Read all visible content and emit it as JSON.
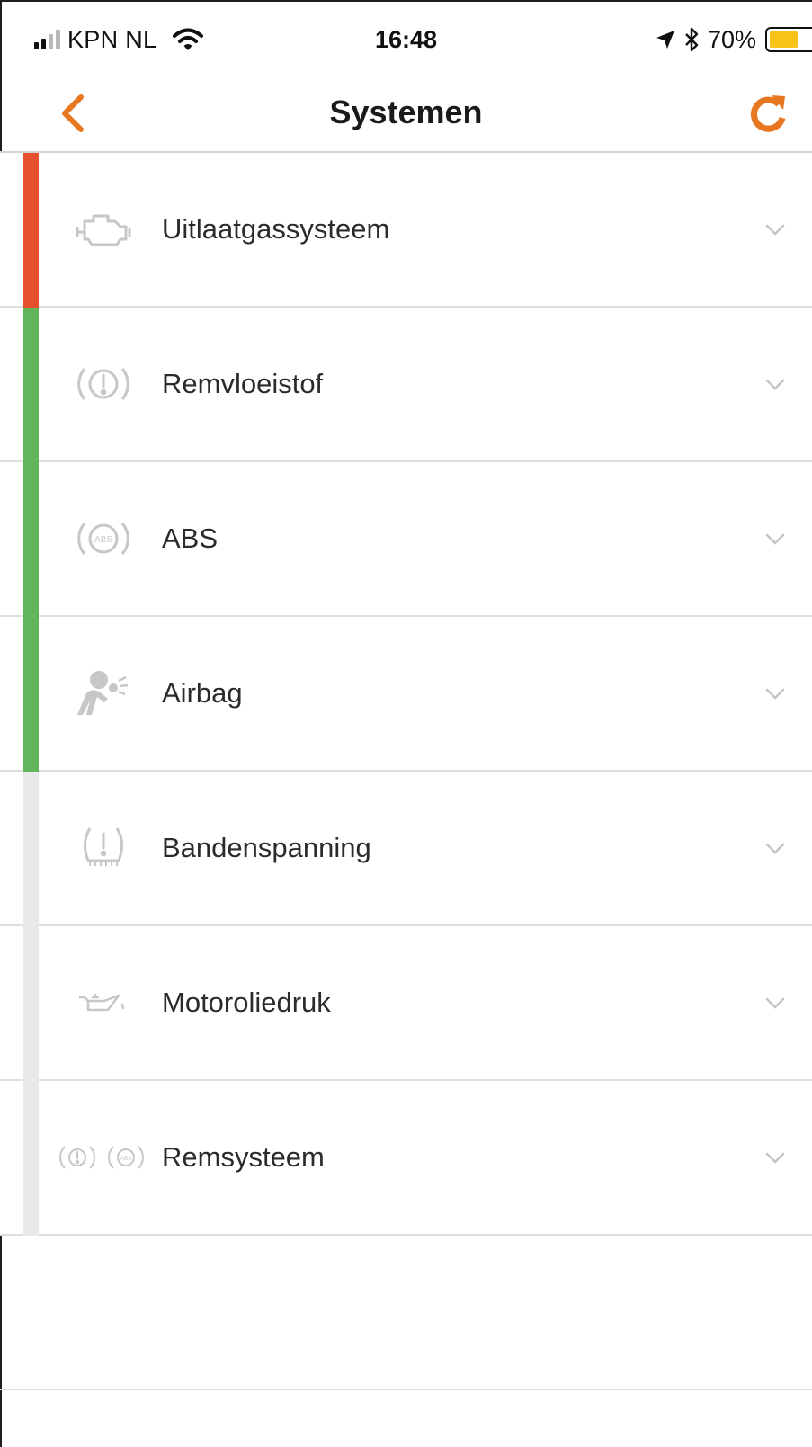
{
  "status_bar": {
    "carrier": "KPN NL",
    "time": "16:48",
    "battery_percent": "70%",
    "battery_level": 0.7,
    "signal_bars_filled": 2,
    "signal_bars_total": 4
  },
  "nav": {
    "title": "Systemen",
    "back_icon": "chevron-left-icon",
    "refresh_icon": "refresh-icon",
    "accent_color": "#e87722"
  },
  "systems": [
    {
      "label": "Uitlaatgassysteem",
      "icon": "engine-icon",
      "status": "error",
      "status_color": "#e5512f"
    },
    {
      "label": "Remvloeistof",
      "icon": "brake-warning-icon",
      "status": "ok",
      "status_color": "#62b55a"
    },
    {
      "label": "ABS",
      "icon": "abs-icon",
      "status": "ok",
      "status_color": "#62b55a"
    },
    {
      "label": "Airbag",
      "icon": "airbag-icon",
      "status": "ok",
      "status_color": "#62b55a"
    },
    {
      "label": "Bandenspanning",
      "icon": "tire-pressure-icon",
      "status": "unknown",
      "status_color": "#e9e9e9"
    },
    {
      "label": "Motoroliedruk",
      "icon": "oil-pressure-icon",
      "status": "unknown",
      "status_color": "#e9e9e9"
    },
    {
      "label": "Remsysteem",
      "icon": "brake-system-icon",
      "status": "unknown",
      "status_color": "#e9e9e9"
    }
  ]
}
